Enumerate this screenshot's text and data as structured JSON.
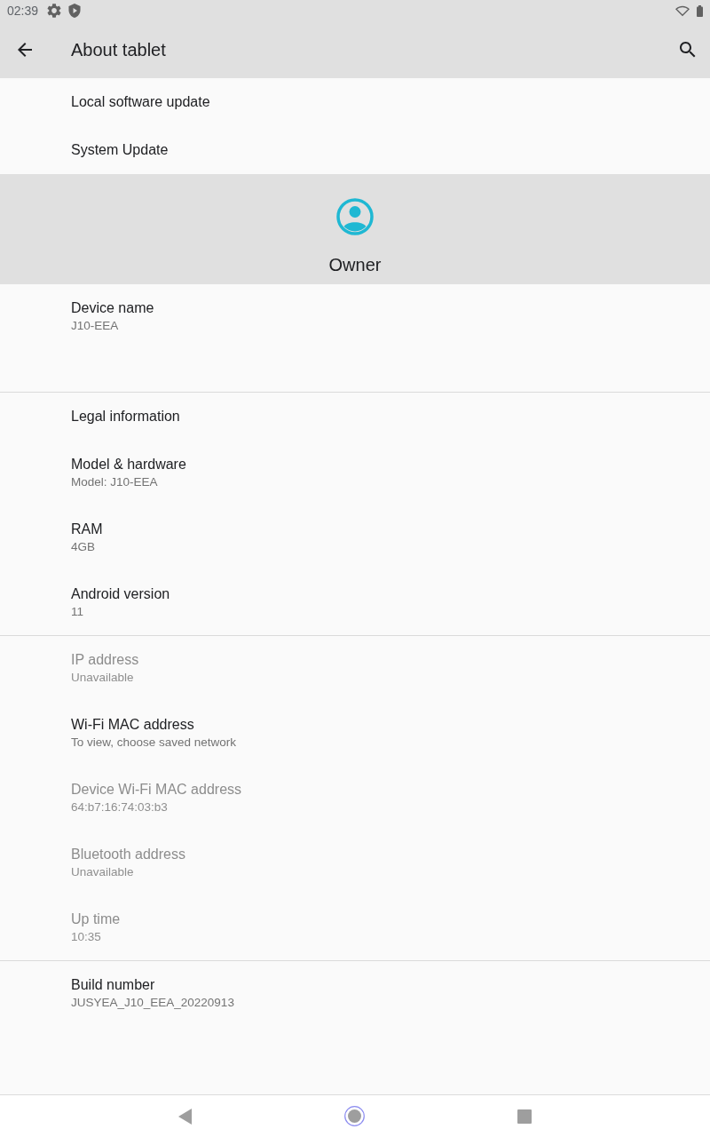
{
  "status_bar": {
    "time": "02:39"
  },
  "app_bar": {
    "title": "About tablet"
  },
  "top_items": [
    {
      "title": "Local software update",
      "disabled": false
    },
    {
      "title": "System Update",
      "disabled": false
    }
  ],
  "owner": {
    "name": "Owner"
  },
  "sections": [
    {
      "items": [
        {
          "title": "Device name",
          "summary": "J10-EEA",
          "disabled": false
        }
      ]
    },
    {
      "items": [
        {
          "title": "Legal information",
          "disabled": false
        },
        {
          "title": "Model & hardware",
          "summary": "Model: J10-EEA",
          "disabled": false
        },
        {
          "title": "RAM",
          "summary": "4GB",
          "disabled": false
        },
        {
          "title": "Android version",
          "summary": "11",
          "disabled": false
        }
      ]
    },
    {
      "items": [
        {
          "title": "IP address",
          "summary": "Unavailable",
          "disabled": true
        },
        {
          "title": "Wi-Fi MAC address",
          "summary": "To view, choose saved network",
          "disabled": false
        },
        {
          "title": "Device Wi-Fi MAC address",
          "summary": "64:b7:16:74:03:b3",
          "disabled": true
        },
        {
          "title": "Bluetooth address",
          "summary": "Unavailable",
          "disabled": true
        },
        {
          "title": "Up time",
          "summary": "10:35",
          "disabled": true
        }
      ]
    },
    {
      "items": [
        {
          "title": "Build number",
          "summary": "JUSYEA_J10_EEA_20220913",
          "disabled": false
        }
      ]
    }
  ]
}
